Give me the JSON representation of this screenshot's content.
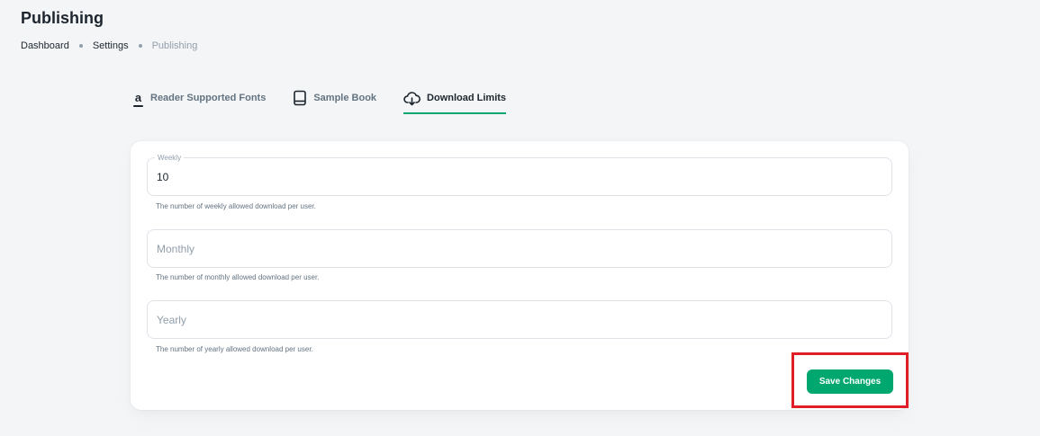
{
  "page": {
    "title": "Publishing"
  },
  "breadcrumb": [
    "Dashboard",
    "Settings",
    "Publishing"
  ],
  "tabs": [
    {
      "label": "Reader Supported Fonts",
      "icon": "amazon-a-icon",
      "active": false
    },
    {
      "label": "Sample Book",
      "icon": "book-icon",
      "active": true
    },
    {
      "label": "Download Limits",
      "icon": "cloud-download-icon",
      "active": true
    }
  ],
  "form": {
    "weekly": {
      "label": "Weekly",
      "value": "10",
      "helper": "The number of weekly allowed download per user."
    },
    "monthly": {
      "placeholder": "Monthly",
      "value": "",
      "helper": "The number of monthly allowed download per user."
    },
    "yearly": {
      "placeholder": "Yearly",
      "value": "",
      "helper": "The number of yearly allowed download per user."
    },
    "save_label": "Save Changes"
  },
  "colors": {
    "accent": "#00a76f",
    "highlight": "#e01e27",
    "background": "#f4f5f6"
  }
}
